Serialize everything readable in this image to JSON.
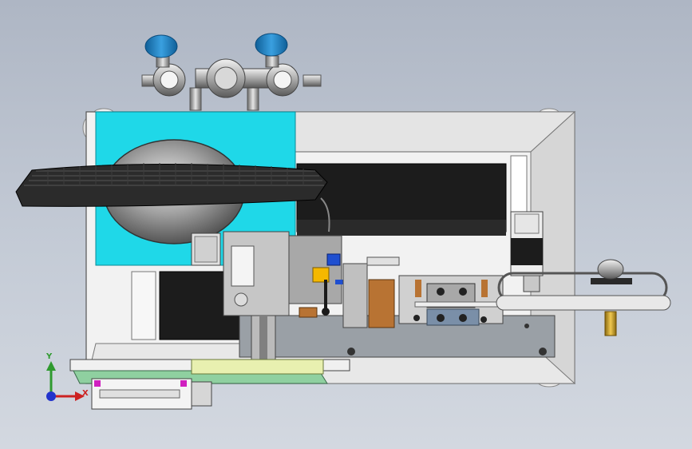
{
  "viewport": {
    "background_top": "#aeb6c4",
    "background_bottom": "#d3d8e0"
  },
  "triad": {
    "y_label": "Y",
    "x_label": "X",
    "y_color": "#2f9a2f",
    "x_color": "#cc2222",
    "z_color": "#2233cc"
  },
  "model": {
    "accent_cyan": "#1fd8e8",
    "valve_knob_blue": "#1f7fc0",
    "housing_white": "#f2f2f2",
    "inner_dark": "#1c1c1c",
    "plate_gray": "#9aa0a6",
    "brass": "#c8a030",
    "copper": "#b87333",
    "pcb_green": "#8fd0a0",
    "magenta_block": "#d020c0"
  }
}
